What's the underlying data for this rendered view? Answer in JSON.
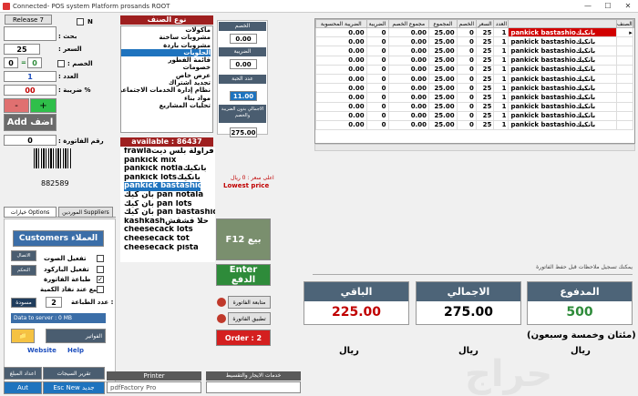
{
  "window": {
    "title": "Connected- POS system Platform prosands ROOT",
    "min": "—",
    "max": "☐",
    "close": "✕"
  },
  "left": {
    "release_btn": "Release 7",
    "n_label": "N",
    "search_label": ": بحث",
    "price_label": ": السعر",
    "price_value": "25",
    "discount_label": ": الخصم",
    "discount_left": "0",
    "discount_eq": "=",
    "discount_right": "0",
    "qty_label": ": العدد",
    "qty_value": "1",
    "tax_label": ": ضريبة %",
    "tax_value": "00",
    "minus": "-",
    "plus": "+",
    "add_btn": "Add اضف",
    "invoice_no_label": ": رقم الفاتورة",
    "invoice_no_value": "0",
    "barcode_text": "882589"
  },
  "tabs": {
    "options": "خيارات Options",
    "suppliers": "الموردين Suppliers"
  },
  "customers": {
    "button": "Customers العملاء",
    "btn_connect": "الاتصال",
    "btn_control": "التحكم",
    "opt1": "تفعيل الصوت",
    "opt2": "تفعيل الباركود",
    "opt3": "طباعة الفاتورة",
    "opt4": "البيع عند نفاذ الكمية",
    "print_count_label": "عدد الطباعة :",
    "print_count_value": "2",
    "draft_btn": "مسودة",
    "data_server": "Data to server : 0 MB",
    "invoices_btn": "الفواتير",
    "website": "Website",
    "help": "Help",
    "report_btn": "تقرير السيجات",
    "settings_btn": "اعداد المبلغ",
    "auto_btn": "Aut",
    "new_btn": "Esc New جديد"
  },
  "categories": {
    "header": "نوع الصنف",
    "items": [
      "مأكولات",
      "مشروبات ساخنة",
      "مشروبات باردة",
      "الحلويات",
      "قائمة الفطور",
      "خصومات",
      "عرض خاص",
      "تجديد اشتراك",
      "نظام إدارة الخدمات الاجتماعية",
      "مواد بناء",
      "تحليات المشاريع"
    ],
    "selected_index": 3
  },
  "calc": {
    "total_label": "الخصم",
    "total_value": "0.00",
    "tax_label": "الضريبة",
    "tax_value": "0.00",
    "num_label": "عدد الحبة",
    "num_value": "11.00",
    "no_tax_label": "الاجمالي بدون الضريبة والخصم",
    "no_tax_value": "275.00"
  },
  "available": "available : 86437",
  "products": {
    "items": [
      "frawlaفراولة بلس ديت",
      "pankick mix",
      "pankick notlaبانكيك",
      "pankick lotsبانكيك",
      "pankick bastashioبانكيك",
      "بان كيك pan notala",
      "بان كيك pan lots",
      "بان كيك pan bastashio",
      "kashkashحلا قشقش",
      "cheesecack lots",
      "cheesecack tot",
      "cheesecack pista"
    ],
    "selected_index": 4
  },
  "price_hint": {
    "line1": "اعلى سعر : 0 ريال",
    "line2": "Lowest price"
  },
  "buttons": {
    "f12": "F12 بيع",
    "enter": "Enter الدفع",
    "follow": "متابعة الفاتورة",
    "apply": "تطبيق الفاتورة",
    "order": "Order : 2"
  },
  "grid": {
    "headers": [
      "الصنف",
      "",
      "العدد",
      "السعر",
      "الخصم",
      "المجموع",
      "مجموع الخصم",
      "الضريبة",
      "الضريبة المحسوبة"
    ],
    "rows": [
      [
        "pankick bastashioبانكيك",
        "1",
        "25",
        "0",
        "25.00",
        "0.00",
        "0",
        "0.00"
      ],
      [
        "pankick bastashioبانكيك",
        "1",
        "25",
        "0",
        "25.00",
        "0.00",
        "0",
        "0.00"
      ],
      [
        "pankick bastashioبانكيك",
        "1",
        "25",
        "0",
        "25.00",
        "0.00",
        "0",
        "0.00"
      ],
      [
        "pankick bastashioبانكيك",
        "1",
        "25",
        "0",
        "25.00",
        "0.00",
        "0",
        "0.00"
      ],
      [
        "pankick bastashioبانكيك",
        "1",
        "25",
        "0",
        "25.00",
        "0.00",
        "0",
        "0.00"
      ],
      [
        "pankick bastashioبانكيك",
        "1",
        "25",
        "0",
        "25.00",
        "0.00",
        "0",
        "0.00"
      ],
      [
        "pankick bastashioبانكيك",
        "1",
        "25",
        "0",
        "25.00",
        "0.00",
        "0",
        "0.00"
      ],
      [
        "pankick bastashioبانكيك",
        "1",
        "25",
        "0",
        "25.00",
        "0.00",
        "0",
        "0.00"
      ],
      [
        "pankick bastashioبانكيك",
        "1",
        "25",
        "0",
        "25.00",
        "0.00",
        "0",
        "0.00"
      ],
      [
        "pankick bastashioبانكيك",
        "1",
        "25",
        "0",
        "25.00",
        "0.00",
        "0",
        "0.00"
      ],
      [
        "pankick bastashioبانكيك",
        "1",
        "25",
        "0",
        "25.00",
        "0.00",
        "0",
        "0.00"
      ]
    ]
  },
  "note_placeholder": "يمكنك تسجيل ملاحظات قبل حفظ الفاتورة",
  "totals": {
    "paid_label": "المدفوع",
    "paid_value": "500",
    "total_label": "الاجمالي",
    "total_value": "275.00",
    "remaining_label": "الباقي",
    "remaining_value": "225.00",
    "words": "(مئتان وخمسة وسبعون)",
    "riyal1": "ريال",
    "riyal2": "ريال",
    "riyal3": "ريال"
  },
  "bottom": {
    "printer_label": "Printer",
    "printer_value": "pdfFactory Pro",
    "service_label": "خدمات الايجار والتقسيط",
    "service_value": ""
  },
  "watermark": "حراج",
  "colors": {
    "accent": "#1e73be",
    "green": "#2e8b3a",
    "red": "#c00000",
    "darkred": "#9e1f1f"
  }
}
